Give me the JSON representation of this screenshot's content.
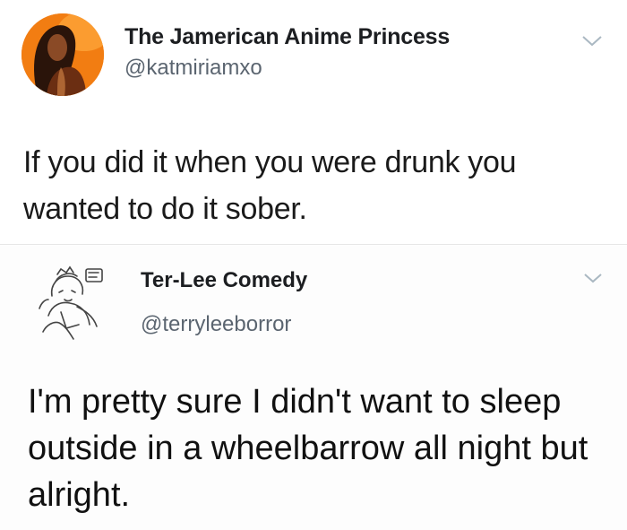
{
  "tweets": [
    {
      "display_name": "The Jamerican Anime Princess",
      "handle": "@katmiriamxo",
      "text": "If you did it when you were drunk you wanted to do it sober.",
      "avatar_icon": "profile-photo-orange"
    },
    {
      "display_name": "Ter-Lee Comedy",
      "handle": "@terryleeborror",
      "text": "I'm pretty sure I didn't want to sleep outside in a wheelbarrow all night but alright.",
      "avatar_icon": "sketch-drawing-avatar"
    }
  ],
  "icons": {
    "menu": "chevron-down-icon"
  },
  "colors": {
    "name_text": "#1c1e21",
    "handle_text": "#5b6570",
    "body_text": "#1a1a1a",
    "avatar_orange": "#f07a10",
    "chevron": "#aab8c2"
  }
}
